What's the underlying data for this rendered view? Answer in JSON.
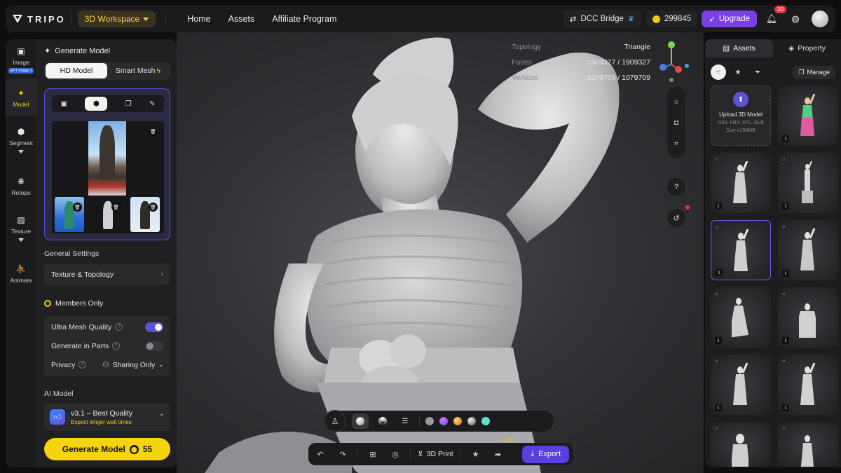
{
  "topbar": {
    "logo": "TRIPO",
    "workspace": "3D Workspace",
    "nav": [
      "Home",
      "Assets",
      "Affiliate Program"
    ],
    "dcc_bridge": "DCC Bridge",
    "credits": "299845",
    "upgrade": "Upgrade",
    "notifications": "30"
  },
  "rail": {
    "image": "Image",
    "image_badge": "GPT Image 2",
    "model": "Model",
    "segment": "Segment",
    "retopo": "Retopo",
    "texture": "Texture",
    "animate": "Animate"
  },
  "panel": {
    "title": "Generate Model",
    "mode_hd": "HD Model",
    "mode_smart": "Smart Mesh",
    "general_settings": "General Settings",
    "texture_topology": "Texture & Topology",
    "members_only": "Members Only",
    "ultra_mesh": "Ultra Mesh Quality",
    "generate_parts": "Generate in Parts",
    "privacy": "Privacy",
    "privacy_value": "Sharing Only",
    "ai_model_label": "AI Model",
    "ai_model_name": "v3.1 – Best Quality",
    "ai_model_note": "Expect longer wait times",
    "generate_button": "Generate Model",
    "generate_cost": "55"
  },
  "viewport": {
    "topology_label": "Topology",
    "topology_value": "Triangle",
    "faces_label": "Faces",
    "faces_value": "1909327 / 1909327",
    "vertices_label": "Vertices",
    "vertices_value": "1079709 / 1079709",
    "help": "?",
    "print_3d": "3D Print",
    "bonus": "+300",
    "export": "Export"
  },
  "right_panel": {
    "tab_assets": "Assets",
    "tab_property": "Property",
    "manage": "Manage",
    "upload_title": "Upload 3D Model",
    "upload_formats": "OBJ, FBX, STL, GLB",
    "upload_size": "Size ≤150MB"
  },
  "colors": {
    "accent_yellow": "#f5d30f",
    "accent_purple": "#5b3fe0",
    "upgrade_purple": "#7b3fe4",
    "viewport_bg": "#3a3a3e"
  }
}
